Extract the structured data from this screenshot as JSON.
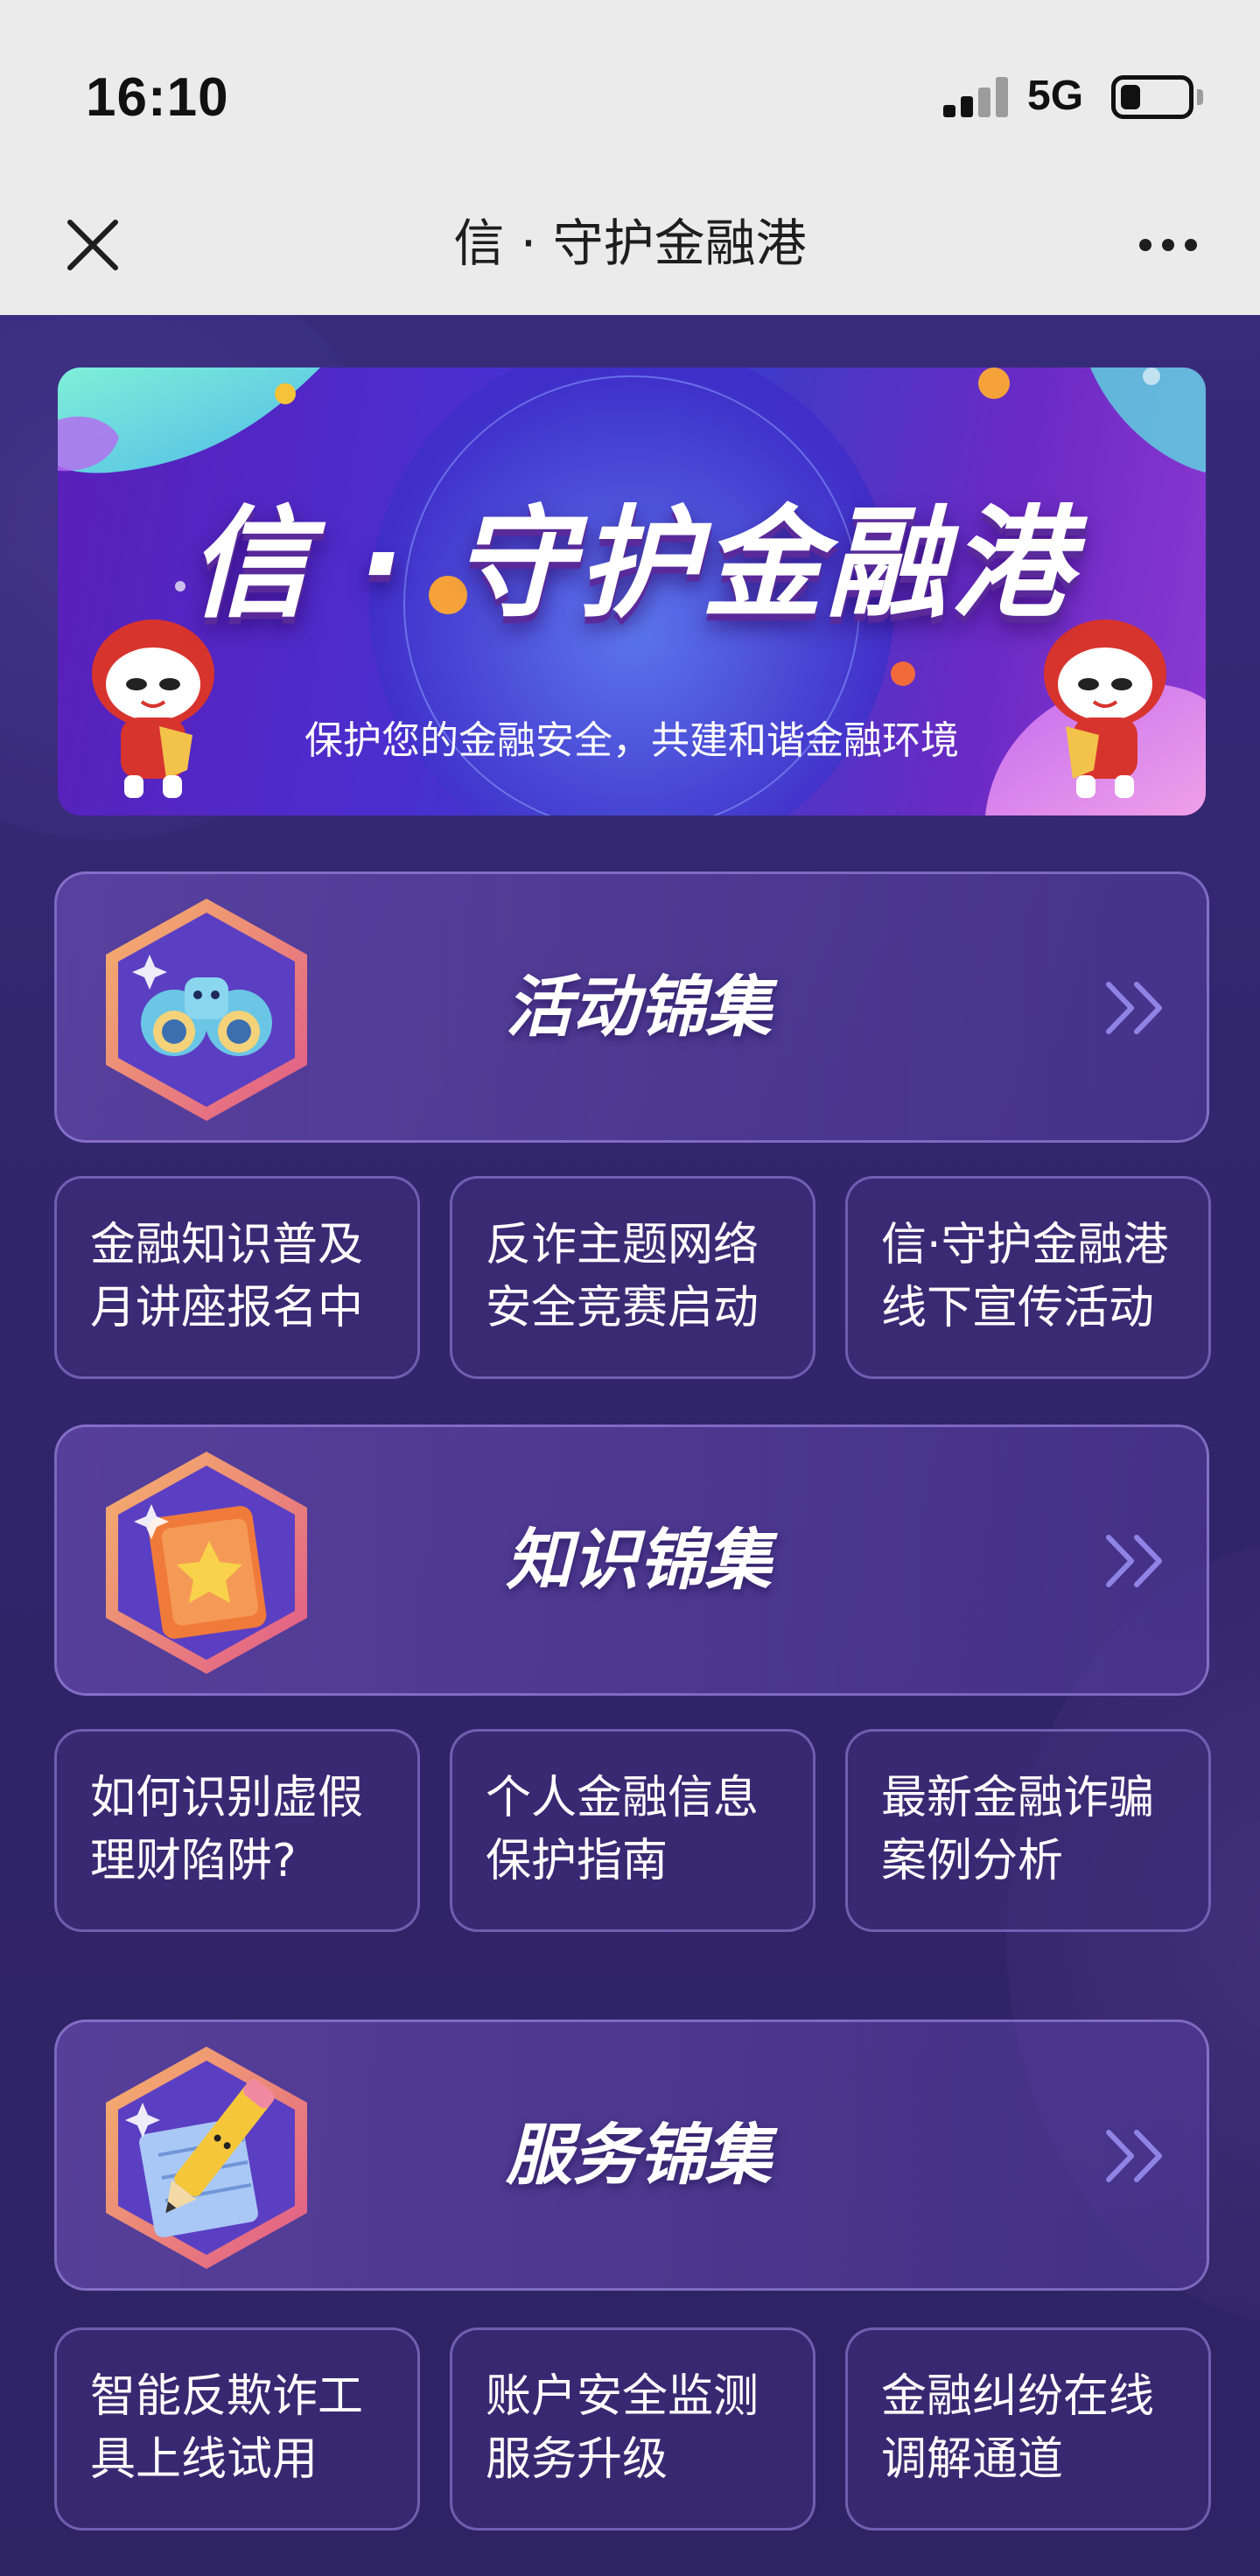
{
  "status_bar": {
    "time": "16:10",
    "network": "5G",
    "battery_level": 0.3,
    "signal_bars_active": 2,
    "icons": [
      "signal-icon",
      "battery-icon"
    ]
  },
  "nav": {
    "title": "信 · 守护金融港",
    "close_icon": "close-icon",
    "more_icon": "more-icon"
  },
  "banner": {
    "title": "信 · 守护金融港",
    "subtitle": "保护您的金融安全，共建和谐金融环境",
    "decor_icons": [
      "mascot-left-icon",
      "mascot-right-icon"
    ]
  },
  "sections": [
    {
      "title": "活动锦集",
      "icon": "binoculars-icon",
      "items": [
        {
          "line1": "金融知识普及",
          "line2": "月讲座报名中"
        },
        {
          "line1": "反诈主题网络",
          "line2": "安全竞赛启动"
        },
        {
          "line1": "信·守护金融港",
          "line2": "线下宣传活动"
        }
      ]
    },
    {
      "title": "知识锦集",
      "icon": "book-icon",
      "items": [
        {
          "line1": "如何识别虚假",
          "line2": "理财陷阱?"
        },
        {
          "line1": "个人金融信息",
          "line2": "保护指南"
        },
        {
          "line1": "最新金融诈骗",
          "line2": "案例分析"
        }
      ]
    },
    {
      "title": "服务锦集",
      "icon": "pencil-icon",
      "items": [
        {
          "line1": "智能反欺诈工",
          "line2": "具上线试用"
        },
        {
          "line1": "账户安全监测",
          "line2": "服务升级"
        },
        {
          "line1": "金融纠纷在线",
          "line2": "调解通道"
        }
      ]
    }
  ],
  "colors": {
    "page_bg": "#31256c",
    "banner_purple": "#4a2fd0",
    "hex_border": "#f08a6a",
    "chevron": "#8f83e6",
    "text": "#ffffff"
  }
}
